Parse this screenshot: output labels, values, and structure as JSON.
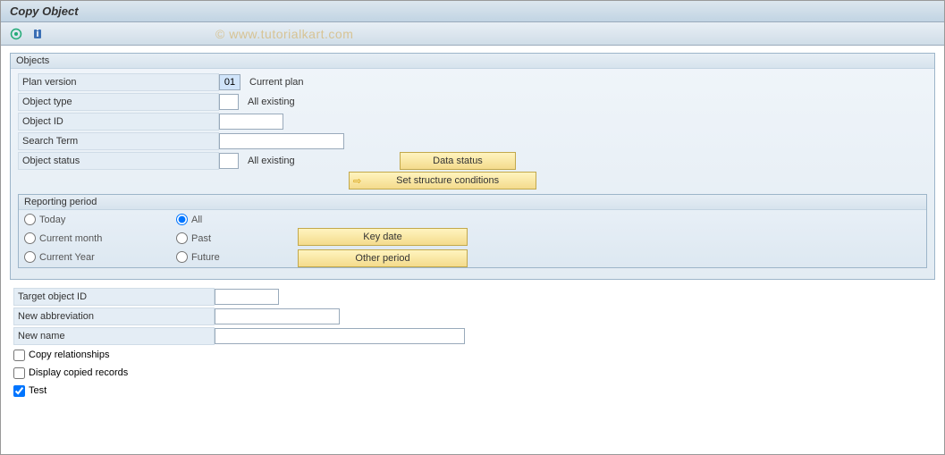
{
  "title": "Copy Object",
  "watermark": "© www.tutorialkart.com",
  "objects": {
    "groupTitle": "Objects",
    "planVersion": {
      "label": "Plan version",
      "value": "01",
      "desc": "Current plan"
    },
    "objectType": {
      "label": "Object type",
      "value": "",
      "desc": "All existing"
    },
    "objectId": {
      "label": "Object ID",
      "value": ""
    },
    "searchTerm": {
      "label": "Search Term",
      "value": ""
    },
    "objectStatus": {
      "label": "Object status",
      "value": "",
      "desc": "All existing"
    },
    "dataStatusBtn": "Data status",
    "setStructureBtn": "Set structure conditions",
    "reporting": {
      "groupTitle": "Reporting period",
      "radios": {
        "today": "Today",
        "currentMonth": "Current month",
        "currentYear": "Current Year",
        "all": "All",
        "past": "Past",
        "future": "Future"
      },
      "selected": "all",
      "keyDateBtn": "Key date",
      "otherPeriodBtn": "Other period"
    }
  },
  "bottom": {
    "targetObjectId": {
      "label": "Target object ID",
      "value": ""
    },
    "newAbbrev": {
      "label": "New abbreviation",
      "value": ""
    },
    "newName": {
      "label": "New name",
      "value": ""
    },
    "copyRel": {
      "label": "Copy relationships",
      "checked": false
    },
    "displayCopied": {
      "label": "Display copied records",
      "checked": false
    },
    "test": {
      "label": "Test",
      "checked": true
    }
  }
}
